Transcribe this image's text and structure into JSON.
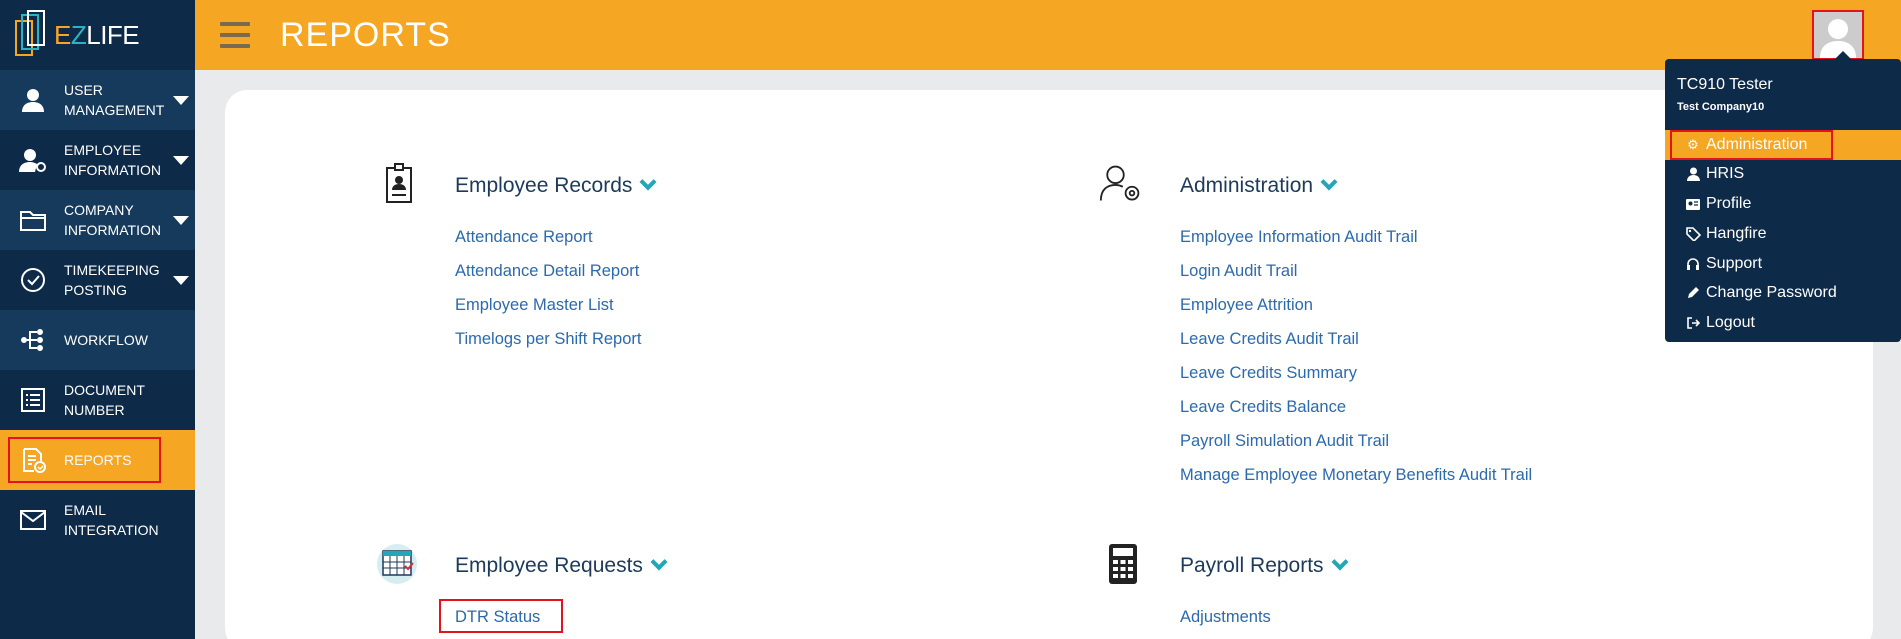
{
  "app": {
    "logo_text_e": "E",
    "logo_text_z": "Z",
    "logo_text_rest": "LIFE"
  },
  "header": {
    "title": "REPORTS"
  },
  "sidebar": {
    "items": [
      {
        "label": "USER MANAGEMENT",
        "icon": "user-icon",
        "has_caret": true
      },
      {
        "label": "EMPLOYEE INFORMATION",
        "icon": "user-gear-icon",
        "has_caret": true
      },
      {
        "label": "COMPANY INFORMATION",
        "icon": "folder-icon",
        "has_caret": true
      },
      {
        "label": "TIMEKEEPING POSTING",
        "icon": "check-circle-icon",
        "has_caret": true
      },
      {
        "label": "WORKFLOW",
        "icon": "workflow-icon",
        "has_caret": false
      },
      {
        "label": "DOCUMENT NUMBER",
        "icon": "list-icon",
        "has_caret": false
      },
      {
        "label": "REPORTS",
        "icon": "report-icon",
        "has_caret": false,
        "active": true
      },
      {
        "label": "EMAIL INTEGRATION",
        "icon": "envelope-icon",
        "has_caret": false
      }
    ]
  },
  "sections": {
    "employee_records": {
      "title": "Employee Records",
      "icon": "id-card-icon",
      "links": [
        "Attendance Report",
        "Attendance Detail Report",
        "Employee Master List",
        "Timelogs per Shift Report"
      ]
    },
    "administration": {
      "title": "Administration",
      "icon": "user-settings-icon",
      "links": [
        "Employee Information Audit Trail",
        "Login Audit Trail",
        "Employee Attrition",
        "Leave Credits Audit Trail",
        "Leave Credits Summary",
        "Leave Credits Balance",
        "Payroll Simulation Audit Trail",
        "Manage Employee Monetary Benefits Audit Trail"
      ]
    },
    "employee_requests": {
      "title": "Employee Requests",
      "icon": "calendar-icon",
      "links": [
        "DTR Status"
      ]
    },
    "payroll_reports": {
      "title": "Payroll Reports",
      "icon": "calculator-icon",
      "links": [
        "Adjustments"
      ]
    }
  },
  "user_menu": {
    "name": "TC910 Tester",
    "company": "Test Company10",
    "items": [
      {
        "label": "Administration",
        "icon": "gear-icon",
        "active": true
      },
      {
        "label": "HRIS",
        "icon": "user-icon"
      },
      {
        "label": "Profile",
        "icon": "id-badge-icon"
      },
      {
        "label": "Hangfire",
        "icon": "tags-icon"
      },
      {
        "label": "Support",
        "icon": "headphones-icon"
      },
      {
        "label": "Change Password",
        "icon": "pencil-icon"
      },
      {
        "label": "Logout",
        "icon": "logout-icon"
      }
    ]
  },
  "colors": {
    "sidebar": "#0d2a49",
    "accent": "#f5a623",
    "link": "#2a6aaf",
    "highlight_box": "#e3121b",
    "chevron": "#22a6b8"
  }
}
